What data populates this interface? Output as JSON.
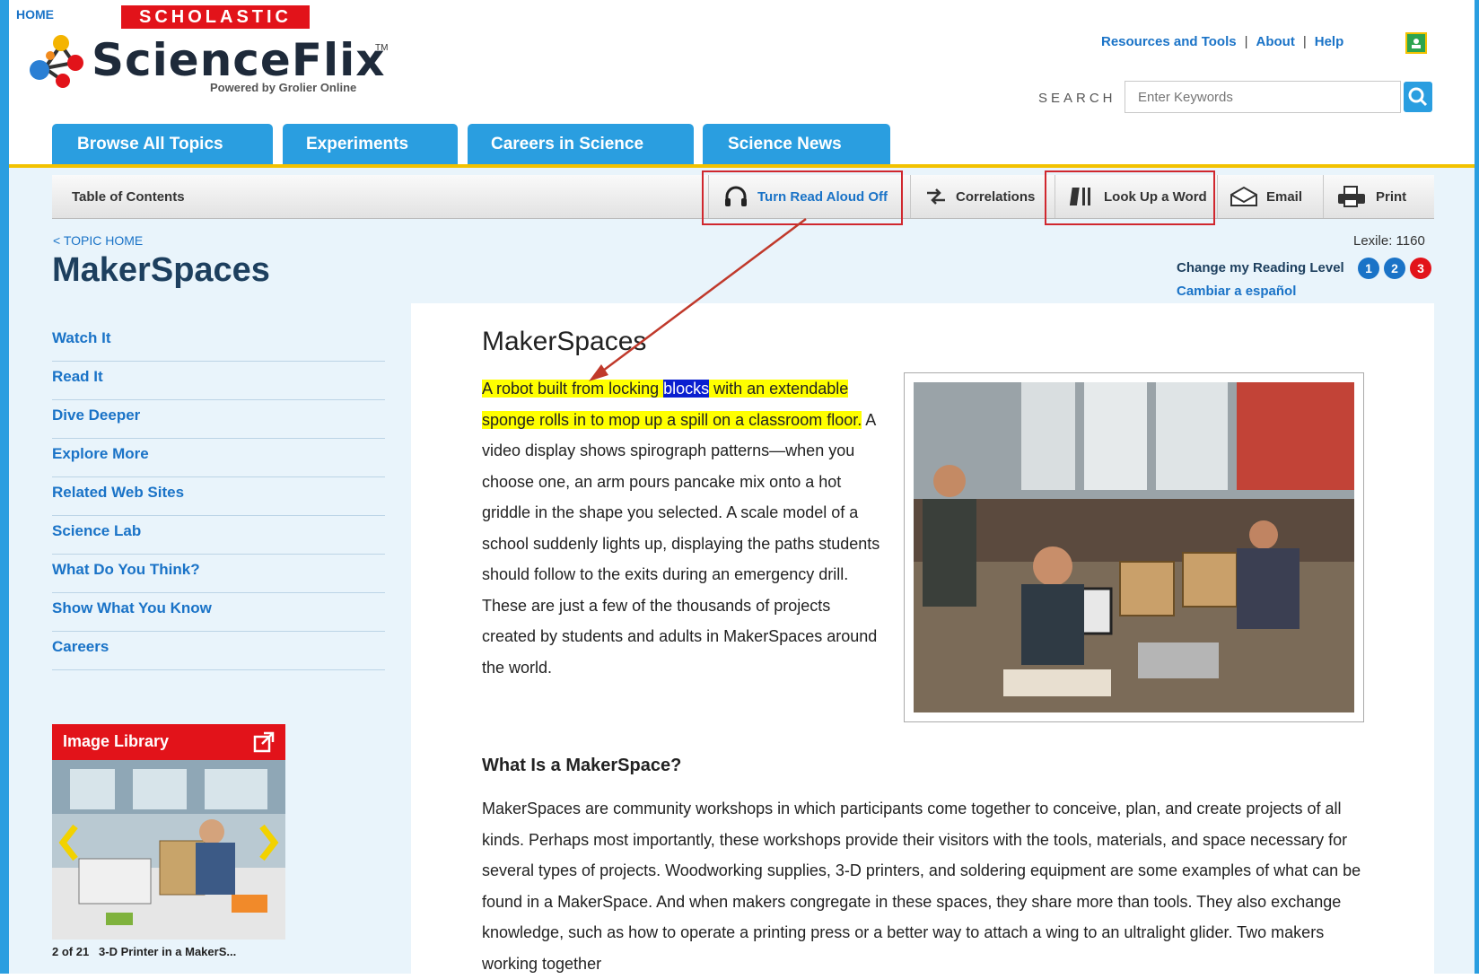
{
  "header": {
    "home": "HOME",
    "scholastic": "SCHOLASTIC",
    "logo_name": "ScienceFlix",
    "logo_tm": "TM",
    "logo_sub": "Powered by Grolier Online",
    "util_links": [
      "Resources and Tools",
      "About",
      "Help"
    ],
    "search_label": "SEARCH",
    "search_placeholder": "Enter Keywords"
  },
  "nav_tabs": [
    "Browse All Topics",
    "Experiments",
    "Careers in Science",
    "Science News"
  ],
  "toolbar": {
    "toc": "Table of Contents",
    "read_aloud": "Turn Read Aloud Off",
    "correlations": "Correlations",
    "look_up": "Look Up a Word",
    "email": "Email",
    "print": "Print"
  },
  "topic": {
    "back": "< TOPIC HOME",
    "title": "MakerSpaces",
    "lexile": "Lexile: 1160",
    "reading_level_label": "Change my Reading Level",
    "levels": [
      "1",
      "2",
      "3"
    ],
    "spanish": "Cambiar a español"
  },
  "side_nav": [
    "Watch It",
    "Read It",
    "Dive Deeper",
    "Explore More",
    "Related Web Sites",
    "Science Lab",
    "What Do You Think?",
    "Show What You Know",
    "Careers"
  ],
  "image_library": {
    "title": "Image Library",
    "counter": "2 of 21",
    "caption": "3-D Printer in a MakerS..."
  },
  "article": {
    "title": "MakerSpaces",
    "hl_a": "A robot built from locking ",
    "hl_word": "blocks",
    "hl_b": " with an extendable sponge rolls in to mop up a spill on a classroom floor.",
    "rest": " A video display shows spirograph patterns—when you choose one, an arm pours pancake mix onto a hot griddle in the shape you selected. A scale model of a school suddenly lights up, displaying the paths students should follow to the exits during an emergency drill. These are just a few of the thousands of projects created by students and adults in MakerSpaces around the world.",
    "section_heading": "What Is a MakerSpace?",
    "section_text": "MakerSpaces are community workshops in which participants come together to conceive, plan, and create projects of all kinds. Perhaps most importantly, these workshops provide their visitors with the tools, materials, and space necessary for several types of projects. Woodworking supplies, 3-D printers, and soldering equipment are some examples of what can be found in a MakerSpace. And when makers congregate in these spaces, they share more than tools. They also exchange knowledge, such as how to operate a printing press or a better way to attach a wing to an ultralight glider. Two makers working together"
  },
  "colors": {
    "brand_blue": "#2a9ee0",
    "link_blue": "#1a73c7",
    "scholastic_red": "#e2131a",
    "highlight_yellow": "#ffff00",
    "annotation_red": "#d0272e"
  }
}
